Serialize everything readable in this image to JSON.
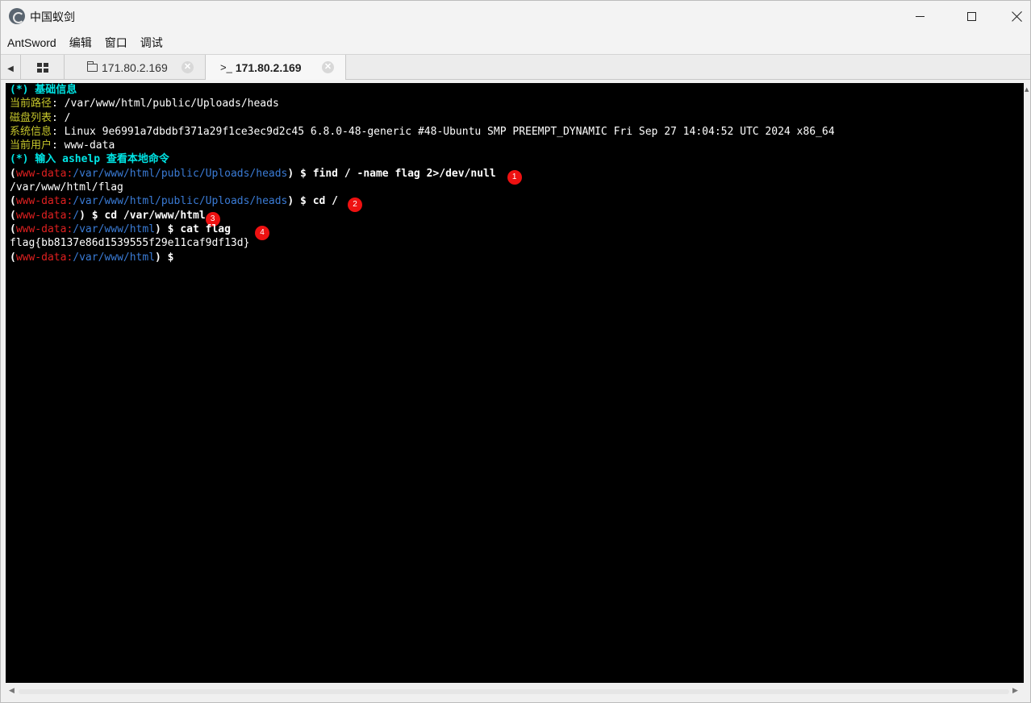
{
  "window": {
    "title": "中国蚁剑"
  },
  "menu": [
    "AntSword",
    "编辑",
    "窗口",
    "调试"
  ],
  "tabs": {
    "file_tab": "171.80.2.169",
    "terminal_tab_prefix": ">_",
    "terminal_tab": "171.80.2.169",
    "close_glyph": "✕"
  },
  "terminal": {
    "banner": {
      "basic_info": "(*) 基础信息",
      "cwd_label": "当前路径",
      "cwd_value": ": /var/www/html/public/Uploads/heads",
      "disk_label": "磁盘列表",
      "disk_value": ": /",
      "sys_label": "系统信息",
      "sys_value": ": Linux 9e6991a7dbdbf371a29f1ce3ec9d2c45 6.8.0-48-generic #48-Ubuntu SMP PREEMPT_DYNAMIC Fri Sep 27 14:04:52 UTC 2024 x86_64",
      "user_label": "当前用户",
      "user_value": ": www-data",
      "help_hint": "(*) 输入 ashelp 查看本地命令"
    },
    "prompt_user": "www-data",
    "lines": [
      {
        "path": "/var/www/html/public/Uploads/heads",
        "command": "find / -name flag 2>/dev/null",
        "marker": "1"
      },
      {
        "output": "/var/www/html/flag"
      },
      {
        "path": "/var/www/html/public/Uploads/heads",
        "command": "cd /",
        "marker": "2"
      },
      {
        "path": "/",
        "command": "cd /var/www/html",
        "marker": "3"
      },
      {
        "path": "/var/www/html",
        "command": "cat flag",
        "marker": "4"
      },
      {
        "output": "flag{bb8137e86d1539555f29e11caf9df13d}"
      },
      {
        "path": "/var/www/html",
        "command": "",
        "marker": ""
      }
    ]
  },
  "colors": {
    "terminal_bg": "#000000",
    "banner_cyan": "#00e5e5",
    "label_yellow": "#c8c82c",
    "prompt_user_red": "#e02020",
    "prompt_path_blue": "#3a7bd5",
    "marker_red": "#ee1111"
  }
}
